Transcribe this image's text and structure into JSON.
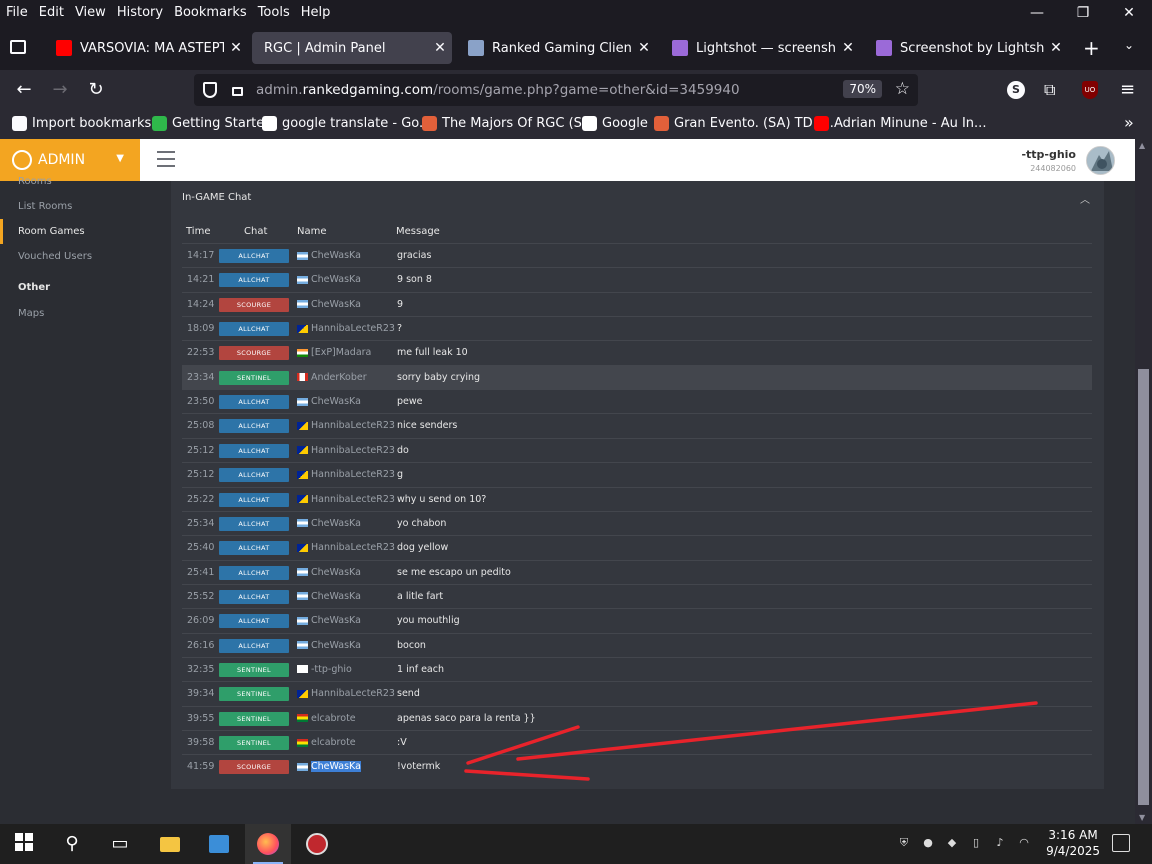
{
  "menu": [
    "File",
    "Edit",
    "View",
    "History",
    "Bookmarks",
    "Tools",
    "Help"
  ],
  "window_controls": {
    "minimize": "—",
    "restore": "❐",
    "close": "✕"
  },
  "tabs": [
    {
      "label": "VARSOVIA: MA ASTEPTAM L",
      "icon": "youtube-icon",
      "color": "#ff0000",
      "active": false
    },
    {
      "label": "RGC | Admin Panel",
      "icon": "",
      "color": "",
      "active": true
    },
    {
      "label": "Ranked Gaming Client",
      "icon": "rgc-icon",
      "color": "#8aa2c8",
      "active": false
    },
    {
      "label": "Lightshot — screenshot tool",
      "icon": "lightshot-icon",
      "color": "#9b6ad8",
      "active": false
    },
    {
      "label": "Screenshot by Lightshot",
      "icon": "lightshot-icon",
      "color": "#9b6ad8",
      "active": false
    }
  ],
  "nav": {
    "url_prefix": "admin.",
    "url_domain": "rankedgaming.com",
    "url_path": "/rooms/game.php?game=other&id=3459940",
    "zoom": "70%"
  },
  "bookmarks": [
    {
      "label": "Import bookmarks...",
      "icon": "import-icon",
      "color": "#fbfbfe"
    },
    {
      "label": "Getting Started",
      "icon": "getting-started-icon",
      "color": "#2fb84b"
    },
    {
      "label": "google translate - Go...",
      "icon": "google-icon",
      "color": "#ffffff"
    },
    {
      "label": "The Majors Of RGC (S...",
      "icon": "rgc-icon",
      "color": "#e2603a"
    },
    {
      "label": "Google",
      "icon": "google-icon",
      "color": "#ffffff"
    },
    {
      "label": "Gran Evento. (SA) TD -...",
      "icon": "rgc-icon",
      "color": "#e2603a"
    },
    {
      "label": "Adrian Minune - Au In...",
      "icon": "youtube-icon",
      "color": "#ff0000"
    }
  ],
  "admin": {
    "brand": "ADMIN",
    "user_name": "-ttp-ghio",
    "user_id": "244082060"
  },
  "sidebar": {
    "partial_top": "Rooms",
    "items": [
      {
        "label": "List Rooms",
        "active": false
      },
      {
        "label": "Room Games",
        "active": true
      },
      {
        "label": "Vouched Users",
        "active": false
      }
    ],
    "section": "Other",
    "section_items": [
      {
        "label": "Maps"
      }
    ]
  },
  "chat": {
    "title": "In-GAME Chat",
    "headers": {
      "time": "Time",
      "chat": "Chat",
      "name": "Name",
      "message": "Message"
    },
    "badge_colors": {
      "ALLCHAT": "#2d74a8",
      "SCOURGE": "#b2453f",
      "SENTINEL": "#2f9e6a"
    },
    "rows": [
      {
        "time": "14:17",
        "chat": "ALLCHAT",
        "name": "CheWasKa",
        "flag": "argentina-flag",
        "msg": "gracias"
      },
      {
        "time": "14:21",
        "chat": "ALLCHAT",
        "name": "CheWasKa",
        "flag": "argentina-flag",
        "msg": "9 son 8"
      },
      {
        "time": "14:24",
        "chat": "SCOURGE",
        "name": "CheWasKa",
        "flag": "argentina-flag",
        "msg": "9"
      },
      {
        "time": "18:09",
        "chat": "ALLCHAT",
        "name": "HannibaLecteR23",
        "flag": "bosnia-flag",
        "msg": "?"
      },
      {
        "time": "22:53",
        "chat": "SCOURGE",
        "name": "[ExP]Madara",
        "flag": "india-flag",
        "msg": "me full leak 10"
      },
      {
        "time": "23:34",
        "chat": "SENTINEL",
        "name": "AnderKober",
        "flag": "canada-flag",
        "msg": "sorry baby crying",
        "highlight": true
      },
      {
        "time": "23:50",
        "chat": "ALLCHAT",
        "name": "CheWasKa",
        "flag": "argentina-flag",
        "msg": "pewe"
      },
      {
        "time": "25:08",
        "chat": "ALLCHAT",
        "name": "HannibaLecteR23",
        "flag": "bosnia-flag",
        "msg": "nice senders"
      },
      {
        "time": "25:12",
        "chat": "ALLCHAT",
        "name": "HannibaLecteR23",
        "flag": "bosnia-flag",
        "msg": "do"
      },
      {
        "time": "25:12",
        "chat": "ALLCHAT",
        "name": "HannibaLecteR23",
        "flag": "bosnia-flag",
        "msg": "g"
      },
      {
        "time": "25:22",
        "chat": "ALLCHAT",
        "name": "HannibaLecteR23",
        "flag": "bosnia-flag",
        "msg": "why u send on 10?"
      },
      {
        "time": "25:34",
        "chat": "ALLCHAT",
        "name": "CheWasKa",
        "flag": "argentina-flag",
        "msg": "yo chabon"
      },
      {
        "time": "25:40",
        "chat": "ALLCHAT",
        "name": "HannibaLecteR23",
        "flag": "bosnia-flag",
        "msg": "dog yellow"
      },
      {
        "time": "25:41",
        "chat": "ALLCHAT",
        "name": "CheWasKa",
        "flag": "argentina-flag",
        "msg": "se me escapo un pedito"
      },
      {
        "time": "25:52",
        "chat": "ALLCHAT",
        "name": "CheWasKa",
        "flag": "argentina-flag",
        "msg": "a litle fart"
      },
      {
        "time": "26:09",
        "chat": "ALLCHAT",
        "name": "CheWasKa",
        "flag": "argentina-flag",
        "msg": "you mouthlig"
      },
      {
        "time": "26:16",
        "chat": "ALLCHAT",
        "name": "CheWasKa",
        "flag": "argentina-flag",
        "msg": "bocon"
      },
      {
        "time": "32:35",
        "chat": "SENTINEL",
        "name": "-ttp-ghio",
        "flag": "cyprus-flag",
        "msg": "1 inf each"
      },
      {
        "time": "39:34",
        "chat": "SENTINEL",
        "name": "HannibaLecteR23",
        "flag": "bosnia-flag",
        "msg": "send"
      },
      {
        "time": "39:55",
        "chat": "SENTINEL",
        "name": "elcabrote",
        "flag": "bolivia-flag",
        "msg": "apenas saco para la renta }}"
      },
      {
        "time": "39:58",
        "chat": "SENTINEL",
        "name": "elcabrote",
        "flag": "bolivia-flag",
        "msg": ":V"
      },
      {
        "time": "41:59",
        "chat": "SCOURGE",
        "name": "CheWasKa",
        "flag": "argentina-flag",
        "msg": "!votermk",
        "selected": true
      }
    ]
  },
  "taskbar": {
    "time": "3:16 AM",
    "date": "9/4/2025"
  }
}
